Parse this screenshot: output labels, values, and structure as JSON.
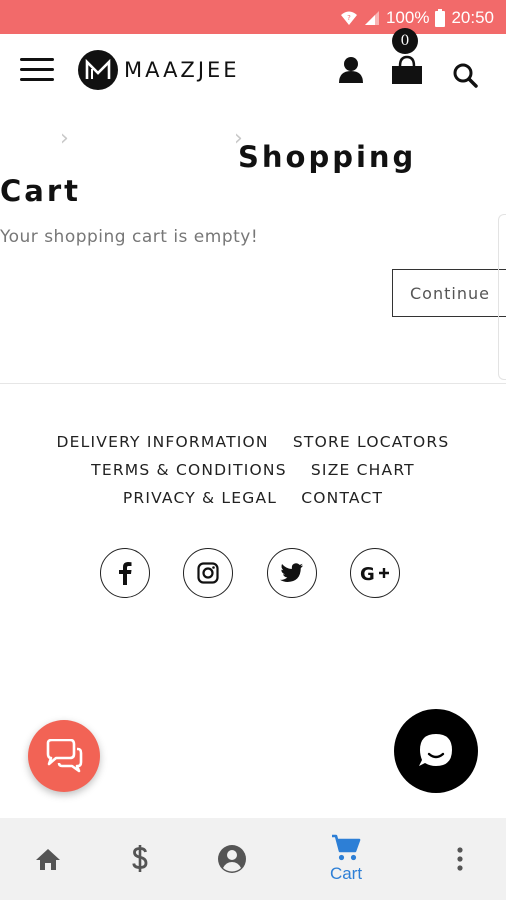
{
  "status_bar": {
    "battery": "100%",
    "time": "20:50"
  },
  "header": {
    "brand": "MAAZJEE",
    "cart_count": "0"
  },
  "page": {
    "title_line1": "Shopping",
    "title_line2": "Cart",
    "empty_message": "Your shopping cart is empty!",
    "continue_label": "Continue"
  },
  "footer": {
    "links_row1": [
      "DELIVERY INFORMATION",
      "STORE LOCATORS"
    ],
    "links_row2": [
      "TERMS & CONDITIONS",
      "SIZE CHART"
    ],
    "links_row3": [
      "PRIVACY & LEGAL",
      "CONTACT"
    ],
    "social": [
      "facebook-icon",
      "instagram-icon",
      "twitter-icon",
      "google-plus-icon"
    ]
  },
  "bottom_nav": {
    "items": [
      "home-icon",
      "dollar-icon",
      "account-icon",
      "cart-icon",
      "more-icon"
    ],
    "active_label": "Cart",
    "active_color": "#2d7fd6"
  },
  "colors": {
    "status_bar": "#f26a6a",
    "chat_fab": "#f26355",
    "help_fab": "#000000"
  }
}
